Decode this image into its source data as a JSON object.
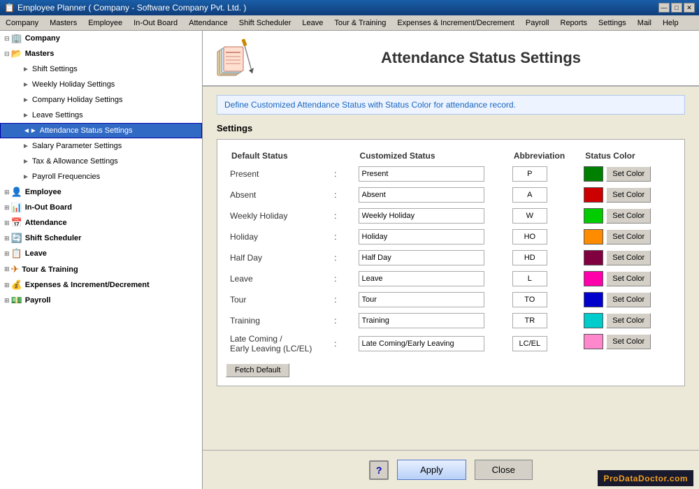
{
  "titleBar": {
    "title": "Employee Planner ( Company - Software Company Pvt. Ltd. )",
    "icon": "📋",
    "buttons": [
      "—",
      "□",
      "✕"
    ]
  },
  "menuBar": {
    "items": [
      "Company",
      "Masters",
      "Employee",
      "In-Out Board",
      "Attendance",
      "Shift Scheduler",
      "Leave",
      "Tour & Training",
      "Expenses & Increment/Decrement",
      "Payroll",
      "Reports",
      "Settings",
      "Mail",
      "Help"
    ]
  },
  "sidebar": {
    "groups": [
      {
        "id": "company",
        "label": "Company",
        "level": 0,
        "icon": "🏢",
        "expanded": true
      },
      {
        "id": "masters",
        "label": "Masters",
        "level": 0,
        "icon": "📂",
        "expanded": true
      },
      {
        "id": "shift-settings",
        "label": "Shift Settings",
        "level": 1,
        "arrow": "►"
      },
      {
        "id": "weekly-holiday",
        "label": "Weekly Holiday Settings",
        "level": 1,
        "arrow": "►"
      },
      {
        "id": "company-holiday",
        "label": "Company Holiday Settings",
        "level": 1,
        "arrow": "►"
      },
      {
        "id": "leave-settings",
        "label": "Leave Settings",
        "level": 1,
        "arrow": "►"
      },
      {
        "id": "attendance-status",
        "label": "Attendance Status Settings",
        "level": 1,
        "arrow": "◄►",
        "active": true
      },
      {
        "id": "salary-param",
        "label": "Salary Parameter Settings",
        "level": 1,
        "arrow": "►"
      },
      {
        "id": "tax-allowance",
        "label": "Tax & Allowance Settings",
        "level": 1,
        "arrow": "►"
      },
      {
        "id": "payroll-freq",
        "label": "Payroll Frequencies",
        "level": 1,
        "arrow": "►"
      },
      {
        "id": "employee",
        "label": "Employee",
        "level": 0,
        "icon": "👤",
        "expanded": false
      },
      {
        "id": "inout-board",
        "label": "In-Out Board",
        "level": 0,
        "icon": "📊",
        "expanded": false
      },
      {
        "id": "attendance",
        "label": "Attendance",
        "level": 0,
        "icon": "📅",
        "expanded": false
      },
      {
        "id": "shift-scheduler",
        "label": "Shift Scheduler",
        "level": 0,
        "icon": "🔄",
        "expanded": false
      },
      {
        "id": "leave",
        "label": "Leave",
        "level": 0,
        "icon": "📋",
        "expanded": false
      },
      {
        "id": "tour-training",
        "label": "Tour & Training",
        "level": 0,
        "icon": "✈",
        "expanded": false
      },
      {
        "id": "expenses",
        "label": "Expenses & Increment/Decrement",
        "level": 0,
        "icon": "💰",
        "expanded": false
      },
      {
        "id": "payroll",
        "label": "Payroll",
        "level": 0,
        "icon": "💵",
        "expanded": false
      }
    ]
  },
  "content": {
    "title": "Attendance Status Settings",
    "defineText": "Define Customized Attendance Status with Status Color for attendance record.",
    "settingsLabel": "Settings",
    "columns": {
      "defaultStatus": "Default Status",
      "customizedStatus": "Customized Status",
      "abbreviation": "Abbreviation",
      "statusColor": "Status Color"
    },
    "rows": [
      {
        "id": "present",
        "defaultStatus": "Present",
        "customizedStatus": "Present",
        "abbreviation": "P",
        "color": "#008000",
        "setColorLabel": "Set Color"
      },
      {
        "id": "absent",
        "defaultStatus": "Absent",
        "customizedStatus": "Absent",
        "abbreviation": "A",
        "color": "#cc0000",
        "setColorLabel": "Set Color"
      },
      {
        "id": "weekly-holiday",
        "defaultStatus": "Weekly Holiday",
        "customizedStatus": "Weekly Holiday",
        "abbreviation": "W",
        "color": "#00cc00",
        "setColorLabel": "Set Color"
      },
      {
        "id": "holiday",
        "defaultStatus": "Holiday",
        "customizedStatus": "Holiday",
        "abbreviation": "HO",
        "color": "#ff8c00",
        "setColorLabel": "Set Color"
      },
      {
        "id": "half-day",
        "defaultStatus": "Half Day",
        "customizedStatus": "Half Day",
        "abbreviation": "HD",
        "color": "#800040",
        "setColorLabel": "Set Color"
      },
      {
        "id": "leave",
        "defaultStatus": "Leave",
        "customizedStatus": "Leave",
        "abbreviation": "L",
        "color": "#ff00aa",
        "setColorLabel": "Set Color"
      },
      {
        "id": "tour",
        "defaultStatus": "Tour",
        "customizedStatus": "Tour",
        "abbreviation": "TO",
        "color": "#0000cc",
        "setColorLabel": "Set Color"
      },
      {
        "id": "training",
        "defaultStatus": "Training",
        "customizedStatus": "Training",
        "abbreviation": "TR",
        "color": "#00cccc",
        "setColorLabel": "Set Color"
      },
      {
        "id": "late-coming",
        "defaultStatus": "Late Coming /\nEarly Leaving (LC/EL)",
        "customizedStatus": "Late Coming/Early Leaving",
        "abbreviation": "LC/EL",
        "color": "#ff88cc",
        "setColorLabel": "Set Color"
      }
    ],
    "fetchDefaultLabel": "Fetch Default",
    "applyLabel": "Apply",
    "closeLabel": "Close",
    "helpLabel": "?",
    "watermark": "ProDataDoctor.com"
  }
}
